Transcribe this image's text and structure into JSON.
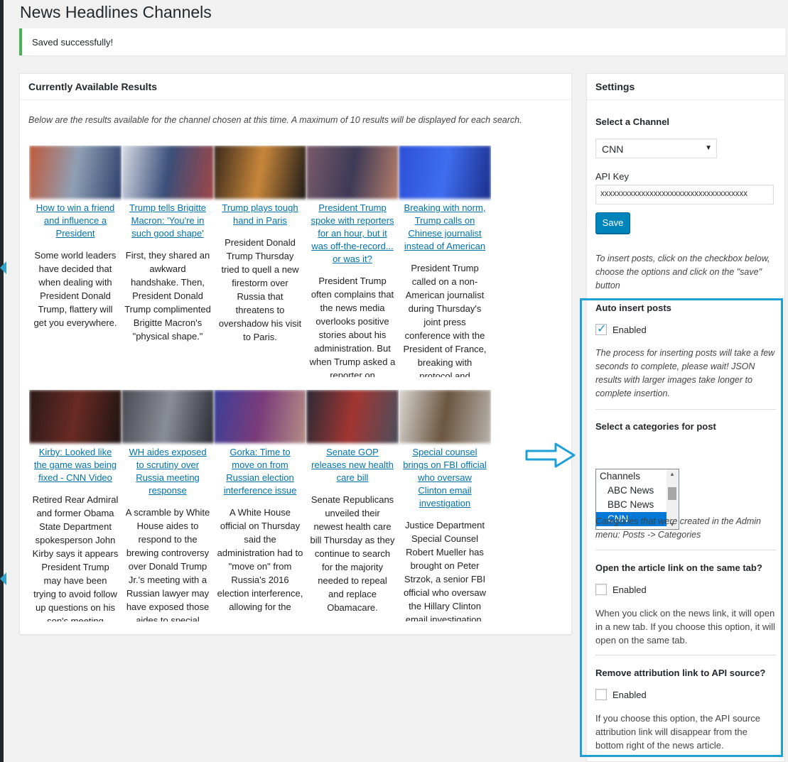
{
  "page_title": "News Headlines Channels",
  "notice": {
    "text": "Saved successfully!",
    "color": "#46b450"
  },
  "results": {
    "title": "Currently Available Results",
    "intro": "Below are the results available for the channel chosen at this time. A maximum of 10 results will be displayed for each search.",
    "items": [
      {
        "title": "How to win a friend and influence a President",
        "desc": "Some world leaders have decided that when dealing with President Donald Trump, flattery will get you everywhere.",
        "thumb_colors": [
          "#c05a3a",
          "#8fa0b5",
          "#2d3f6a"
        ]
      },
      {
        "title": "Trump tells Brigitte Macron: 'You're in such good shape'",
        "desc": "First, they shared an awkward handshake. Then, President Donald Trump complimented Brigitte Macron's \"physical shape.\"",
        "thumb_colors": [
          "#d9dde6",
          "#3a4f7a",
          "#a04646"
        ]
      },
      {
        "title": "Trump plays tough hand in Paris",
        "desc": "President Donald Trump Thursday tried to quell a new firestorm over Russia that threatens to overshadow his visit to Paris.",
        "thumb_colors": [
          "#3a2a1c",
          "#c9873a",
          "#1d1a18"
        ]
      },
      {
        "title": "President Trump spoke with reporters for an hour, but it was off-the-record... or was it?",
        "desc": "President Trump often complains that the news media overlooks positive stories about his administration. But when Trump asked a reporter on",
        "thumb_colors": [
          "#7a5a6a",
          "#3d3a56",
          "#b77e6a"
        ]
      },
      {
        "title": "Breaking with norm, Trump calls on Chinese journalist instead of American",
        "desc": "President Trump called on a non-American journalist during Thursday's joint press conference with the President of France, breaking with protocol and",
        "thumb_colors": [
          "#2c4fd6",
          "#3f6ef0",
          "#1b2f8c"
        ]
      },
      {
        "title": "Kirby: Looked like the game was being fixed - CNN Video",
        "desc": "Retired Rear Admiral and former Obama State Department spokesperson John Kirby says it appears President Trump may have been trying to avoid follow up questions on his son's meeting",
        "thumb_colors": [
          "#2a1a18",
          "#6a2a24",
          "#1d1412"
        ]
      },
      {
        "title": "WH aides exposed to scrutiny over Russia meeting response",
        "desc": "A scramble by White House aides to respond to the brewing controversy over Donald Trump Jr.'s meeting with a Russian lawyer may have exposed those aides to special",
        "thumb_colors": [
          "#4a4a52",
          "#8a8e98",
          "#2b2c34"
        ]
      },
      {
        "title": "Gorka: Time to move on from Russian election interference issue",
        "desc": "A White House official on Thursday said the administration had to \"move on\" from Russia's 2016 election interference, allowing for the",
        "thumb_colors": [
          "#3a3f9a",
          "#7b3c7a",
          "#b58f86"
        ]
      },
      {
        "title": "Senate GOP releases new health care bill",
        "desc": "Senate Republicans unveiled their newest health care bill Thursday as they continue to search for the majority needed to repeal and replace Obamacare.",
        "thumb_colors": [
          "#2b2a36",
          "#a23632",
          "#4a4e5c"
        ]
      },
      {
        "title": "Special counsel brings on FBI official who oversaw Clinton email investigation",
        "desc": "Justice Department Special Counsel Robert Mueller has brought on Peter Strzok, a senior FBI official who oversaw the Hillary Clinton email investigation.",
        "thumb_colors": [
          "#d9d7d2",
          "#6b5540",
          "#b7b2aa"
        ]
      }
    ]
  },
  "settings": {
    "title": "Settings",
    "channel_label": "Select a Channel",
    "channel_value": "CNN",
    "api_key_label": "API Key",
    "api_key_value": "xxxxxxxxxxxxxxxxxxxxxxxxxxxxxxxxxxxx",
    "save_label": "Save",
    "insert_help": "To insert posts, click on the checkbox below, choose the options and click on the \"save\" button",
    "auto_insert": {
      "heading": "Auto insert posts",
      "checkbox_label": "Enabled",
      "checked": true,
      "note": "The process for inserting posts will take a few seconds to complete, please wait! JSON results with larger images take longer to complete insertion."
    },
    "categories": {
      "heading": "Select a categories for post",
      "options": [
        "Channels",
        "ABC News",
        "BBC News",
        "CNN"
      ],
      "selected": "CNN",
      "note": "Categories that were created in the Admin menu: Posts -> Categories"
    },
    "same_tab": {
      "heading": "Open the article link on the same tab?",
      "checkbox_label": "Enabled",
      "checked": false,
      "note": "When you click on the news link, it will open in a new tab. If you choose this option, it will open on the same tab."
    },
    "attribution": {
      "heading": "Remove attribution link to API source?",
      "checkbox_label": "Enabled",
      "checked": false,
      "note": "If you choose this option, the API source attribution link will disappear from the bottom right of the news article."
    }
  },
  "colors": {
    "accent": "#0085ba",
    "link": "#0073aa",
    "highlight": "#1e9fd6"
  }
}
